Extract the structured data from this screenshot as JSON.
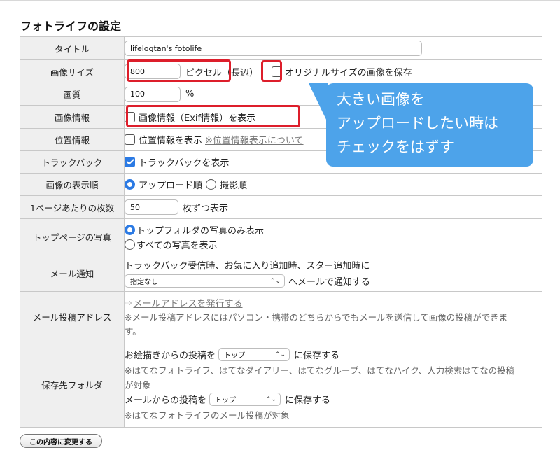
{
  "page": {
    "heading": "フォトライフの設定"
  },
  "rows": {
    "title": {
      "label": "タイトル",
      "value": "lifelogtan's fotolife"
    },
    "image_size": {
      "label": "画像サイズ",
      "value": "800",
      "unit": "ピクセル（長辺）",
      "keep_original_label": "オリジナルサイズの画像を保存",
      "keep_original_checked": false
    },
    "quality": {
      "label": "画質",
      "value": "100",
      "unit": "%"
    },
    "image_info": {
      "label": "画像情報",
      "checkbox_label": "画像情報（Exif情報）を表示",
      "checked": false
    },
    "location": {
      "label": "位置情報",
      "checkbox_label": "位置情報を表示",
      "link": "※位置情報表示について",
      "checked": false
    },
    "trackback": {
      "label": "トラックバック",
      "checkbox_label": "トラックバックを表示",
      "checked": true
    },
    "display_order": {
      "label": "画像の表示順",
      "options": [
        "アップロード順",
        "撮影順"
      ],
      "selected": "アップロード順"
    },
    "per_page": {
      "label": "1ページあたりの枚数",
      "value": "50",
      "suffix": "枚ずつ表示"
    },
    "top_photo": {
      "label": "トップページの写真",
      "options": [
        "トップフォルダの写真のみ表示",
        "すべての写真を表示"
      ],
      "selected": "トップフォルダの写真のみ表示"
    },
    "mail_notify": {
      "label": "メール通知",
      "description": "トラックバック受信時、お気に入り追加時、スター追加時に",
      "select_value": "指定なし",
      "suffix": "へメールで通知する"
    },
    "mail_post": {
      "label": "メール投稿アドレス",
      "arrow": "⇨",
      "link": "メールアドレスを発行する",
      "note_line1": "※メール投稿アドレスにはパソコン・携帯のどちらからでもメールを送信して画像の投稿ができま",
      "note_line2": "す。"
    },
    "save_folder": {
      "label": "保存先フォルダ",
      "drawing_prefix": "お絵描きからの投稿を",
      "drawing_select": "トップ",
      "drawing_suffix": "に保存する",
      "drawing_note_line1": "※はてなフォトライフ、はてなダイアリー、はてなグループ、はてなハイク、人力検索はてなの投稿",
      "drawing_note_line2": "が対象",
      "mail_prefix": "メールからの投稿を",
      "mail_select": "トップ",
      "mail_suffix": "に保存する",
      "mail_note": "※はてなフォトライフのメール投稿が対象"
    }
  },
  "submit_label": "この内容に変更する",
  "callout": {
    "line1": "大きい画像を",
    "line2": "アップロードしたい時は",
    "line3": "チェックをはずす"
  },
  "colors": {
    "highlight_red": "#dd1e2b",
    "callout_blue": "#4da3ea",
    "checked_blue": "#2b7ae4"
  }
}
